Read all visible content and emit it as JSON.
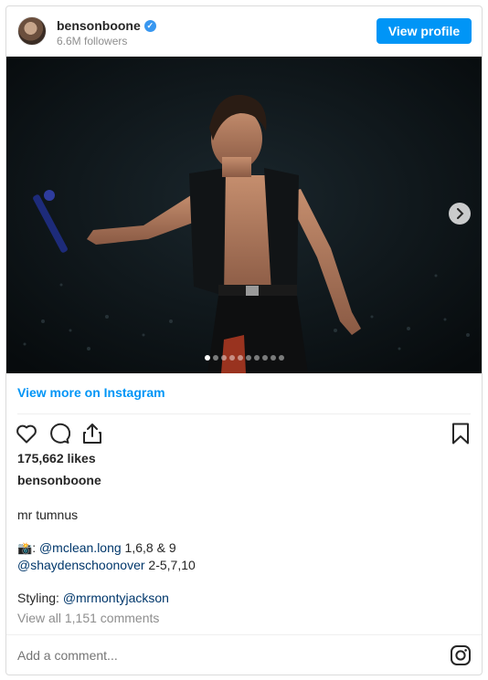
{
  "header": {
    "username": "bensonboone",
    "verified_mark": "✓",
    "followers": "6.6M followers",
    "view_profile_label": "View profile"
  },
  "carousel": {
    "slide_count": 10,
    "active_index": 0,
    "next_icon": "chevron-right-icon"
  },
  "view_more_label": "View more on Instagram",
  "actions": {
    "like_icon": "heart-icon",
    "comment_icon": "comment-icon",
    "share_icon": "share-icon",
    "save_icon": "bookmark-icon"
  },
  "likes": "175,662 likes",
  "author": "bensonboone",
  "caption": {
    "line1": "mr tumnus",
    "photo_emoji": "📸",
    "photo_prefix": ": ",
    "mention1": "@mclean.long",
    "mention1_suffix": " 1,6,8 & 9",
    "mention2": "@shaydenschoonover",
    "mention2_suffix": " 2-5,7,10",
    "styling_prefix": "Styling: ",
    "mention3": "@mrmontyjackson"
  },
  "view_comments": "View all 1,151 comments",
  "comment_placeholder": "Add a comment...",
  "brand_icon": "instagram-icon",
  "colors": {
    "accent": "#0095f6",
    "mention": "#00376b",
    "muted": "#8e8e8e",
    "text": "#262626"
  }
}
